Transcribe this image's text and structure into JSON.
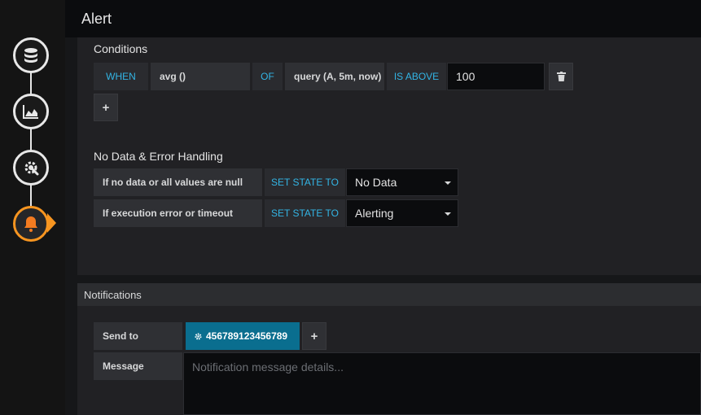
{
  "header": {
    "title": "Alert"
  },
  "rail": {
    "steps": [
      {
        "icon": "database-icon"
      },
      {
        "icon": "chart-area-icon"
      },
      {
        "icon": "gear-wrench-icon"
      },
      {
        "icon": "bell-icon",
        "active": true
      }
    ]
  },
  "conditions": {
    "title": "Conditions",
    "when": "WHEN",
    "reducer": "avg ()",
    "of": "OF",
    "query": "query (A, 5m, now)",
    "evaluator": "IS ABOVE",
    "threshold": "100",
    "delete_icon": "trash-icon",
    "add_label": "+"
  },
  "no_data": {
    "title": "No Data & Error Handling",
    "rows": [
      {
        "label": "If no data or all values are null",
        "action": "SET STATE TO",
        "value": "No Data"
      },
      {
        "label": "If execution error or timeout",
        "action": "SET STATE TO",
        "value": "Alerting"
      }
    ]
  },
  "notifications": {
    "title": "Notifications",
    "send_to_label": "Send to",
    "channel": "456789123456789",
    "channel_icon": "gear-icon",
    "add_label": "+",
    "message_label": "Message",
    "message_placeholder": "Notification message details..."
  },
  "colors": {
    "accent": "#33b5e5",
    "active_step": "#f79520",
    "channel_tag": "#0a6e8f"
  }
}
